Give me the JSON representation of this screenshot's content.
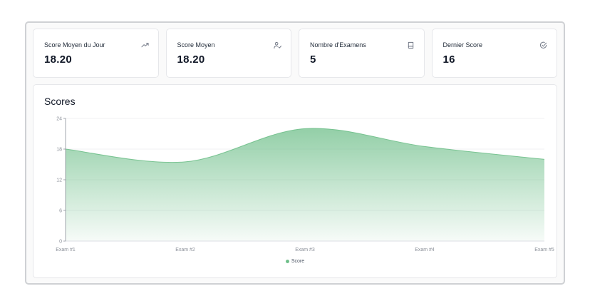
{
  "stats": [
    {
      "title": "Score Moyen du Jour",
      "value": "18.20",
      "icon": "trending-up-icon"
    },
    {
      "title": "Score Moyen",
      "value": "18.20",
      "icon": "user-check-icon"
    },
    {
      "title": "Nombre d'Examens",
      "value": "5",
      "icon": "book-icon"
    },
    {
      "title": "Dernier Score",
      "value": "16",
      "icon": "check-circle-icon"
    }
  ],
  "chart_title": "Scores",
  "chart_data": {
    "type": "area",
    "title": "Scores",
    "categories": [
      "Exam #1",
      "Exam #2",
      "Exam #3",
      "Exam #4",
      "Exam #5"
    ],
    "series": [
      {
        "name": "Score",
        "values": [
          18,
          15.5,
          22,
          18.5,
          16
        ],
        "color": "#6fbf8a"
      }
    ],
    "ylim": [
      0,
      24
    ],
    "yticks": [
      "0",
      "6",
      "12",
      "18",
      "24"
    ],
    "grid": true,
    "legend": "bottom-center"
  },
  "colors": {
    "accent": "#6fbf8a",
    "icon": "#6b7280"
  }
}
